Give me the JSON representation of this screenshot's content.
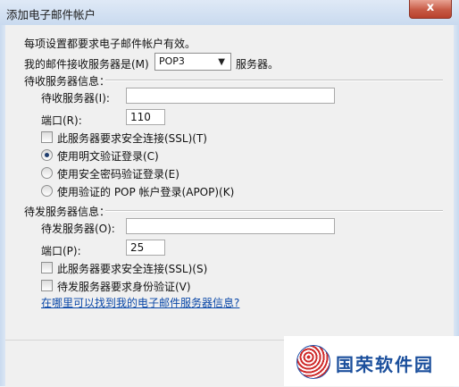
{
  "window": {
    "title": "添加电子邮件帐户",
    "close_label": "x"
  },
  "intro": "每项设置都要求电子邮件帐户有效。",
  "incoming_server_type": {
    "label": "我的邮件接收服务器是(M)",
    "selected": "POP3",
    "suffix": "服务器。"
  },
  "incoming_section": {
    "heading": "待收服务器信息：",
    "server_label": "待收服务器(I):",
    "server_value": "",
    "port_label": "端口(R):",
    "port_value": "110",
    "ssl_label": "此服务器要求安全连接(SSL)(T)",
    "ssl_checked": false,
    "auth_options": [
      {
        "label": "使用明文验证登录(C)",
        "checked": true
      },
      {
        "label": "使用安全密码验证登录(E)",
        "checked": false
      },
      {
        "label": "使用验证的 POP 帐户登录(APOP)(K)",
        "checked": false
      }
    ]
  },
  "outgoing_section": {
    "heading": "待发服务器信息：",
    "server_label": "待发服务器(O):",
    "server_value": "",
    "port_label": "端口(P):",
    "port_value": "25",
    "ssl_label": "此服务器要求安全连接(SSL)(S)",
    "ssl_checked": false,
    "auth_label": "待发服务器要求身份验证(V)",
    "auth_checked": false
  },
  "help_link": "在哪里可以找到我的电子邮件服务器信息?",
  "watermark": {
    "text": "国荣软件园"
  }
}
